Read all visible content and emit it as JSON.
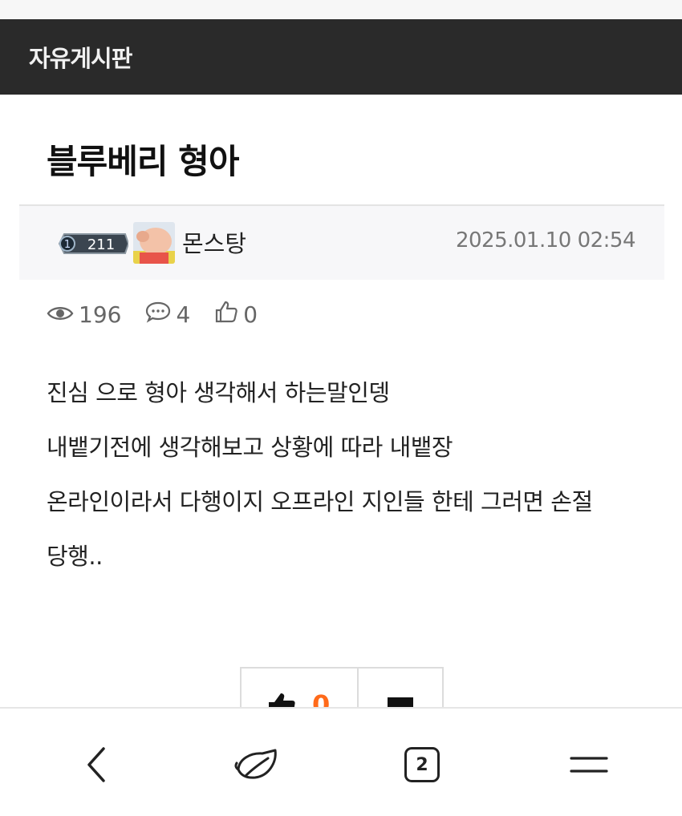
{
  "header": {
    "board_title": "자유게시판"
  },
  "post": {
    "title": "블루베리 형아",
    "author": {
      "level": "211",
      "name": "몬스탕"
    },
    "date": "2025.01.10 02:54",
    "stats": {
      "views": "196",
      "comments": "4",
      "likes": "0"
    },
    "body_lines": [
      "진심 으로 형아 생각해서 하는말인뎅",
      "내뱉기전에 생각해보고 상황에 따라 내뱉장",
      "온라인이라서 다행이지 오프라인 지인들 한테 그러면 손절",
      "당행.."
    ]
  },
  "vote": {
    "like_count": "0"
  },
  "bottom_nav": {
    "tab_count": "2"
  },
  "colors": {
    "header_bg": "#2a2a2a",
    "vote_accent": "#ff6a1a",
    "meta_gray": "#777777"
  },
  "icons": [
    "eye-icon",
    "comment-icon",
    "thumbs-up-icon",
    "back-icon",
    "whale-logo-icon",
    "menu-icon"
  ]
}
